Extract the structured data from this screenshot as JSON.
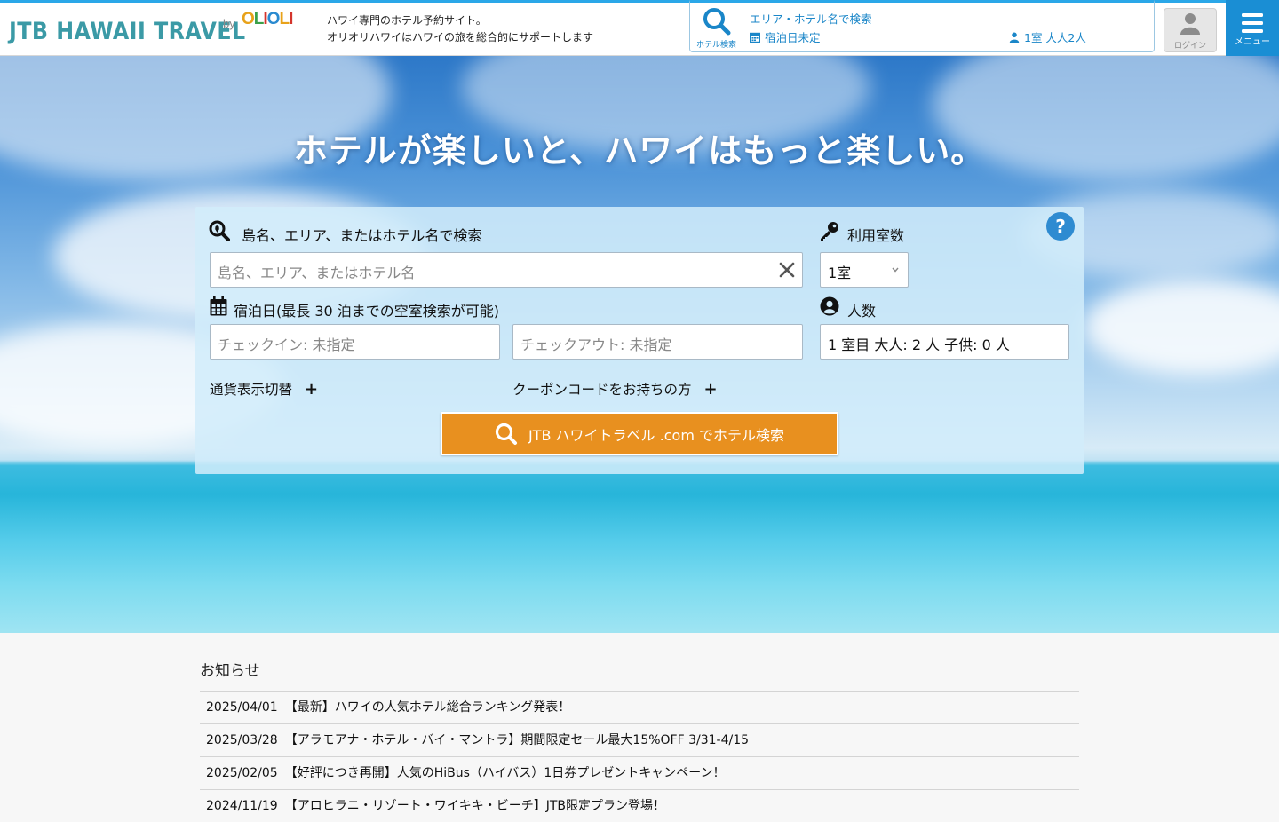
{
  "header": {
    "logo_text": "JTB HAWAII TRAVEL",
    "logo_by": "by",
    "logo_brand": "OLIOLI",
    "tagline_1": "ハワイ専門のホテル予約サイト。",
    "tagline_2": "オリオリハワイはハワイの旅を総合的にサポートします",
    "search_btn_label": "ホテル検索",
    "search_area": "エリア・ホテル名で検索",
    "search_dates": "宿泊日未定",
    "search_guests": "1室 大人2人",
    "login_label": "ログイン",
    "menu_label": "メニュー"
  },
  "hero": {
    "title": "ホテルが楽しいと、ハワイはもっと楽しい。"
  },
  "search_panel": {
    "keyword_label": "島名、エリア、またはホテル名で検索",
    "keyword_placeholder": "島名、エリア、またはホテル名",
    "rooms_label": "利用室数",
    "rooms_value": "1室",
    "dates_label": "宿泊日(最長 30 泊までの空室検索が可能)",
    "checkin_placeholder": "チェックイン: 未指定",
    "checkout_placeholder": "チェックアウト: 未指定",
    "guests_label": "人数",
    "guests_value": "1 室目 大人: 2 人 子供: 0 人",
    "currency_toggle": "通貨表示切替",
    "coupon_toggle": "クーポンコードをお持ちの方",
    "plus": "+",
    "help": "?",
    "submit_label": "JTB ハワイトラベル .com でホテル検索"
  },
  "news": {
    "title": "お知らせ",
    "items": [
      {
        "date": "2025/04/01",
        "text": "【最新】ハワイの人気ホテル総合ランキング発表！"
      },
      {
        "date": "2025/03/28",
        "text": "【アラモアナ・ホテル・バイ・マントラ】期間限定セール最大15%OFF 3/31-4/15"
      },
      {
        "date": "2025/02/05",
        "text": "【好評につき再開】人気のHiBus（ハイバス）1日券プレゼントキャンペーン！"
      },
      {
        "date": "2024/11/19",
        "text": "【アロヒラニ・リゾート・ワイキキ・ビーチ】JTB限定プラン登場！"
      }
    ]
  },
  "colors": {
    "accent_blue": "#1a8ed4",
    "search_orange": "#e8901f",
    "logo_teal": "#3b9aa6"
  }
}
